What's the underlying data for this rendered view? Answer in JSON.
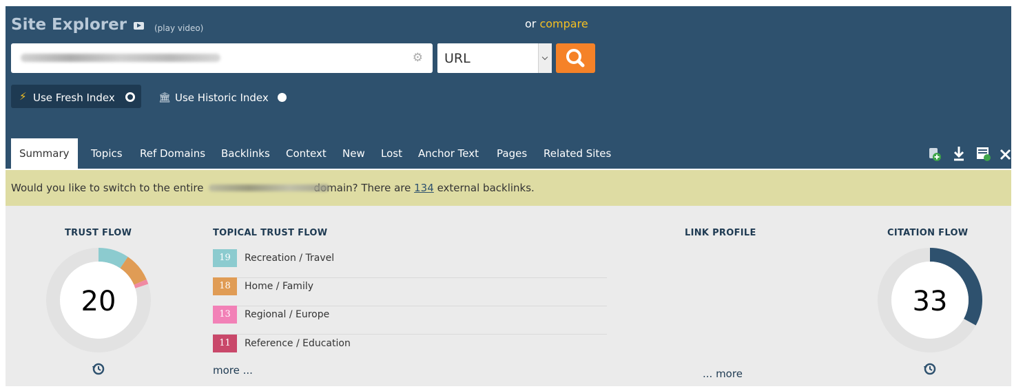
{
  "header": {
    "title": "Site Explorer",
    "video_icon": "play-video-icon",
    "play_video": "(play video)",
    "or_text": "or",
    "compare": "compare"
  },
  "search": {
    "gear_icon": "gear-icon",
    "mode": "URL",
    "search_icon": "magnifier-icon"
  },
  "index": {
    "fresh_label": "Use Fresh Index",
    "historic_label": "Use Historic Index",
    "selected": "fresh"
  },
  "tabs": [
    {
      "label": "Summary",
      "active": true
    },
    {
      "label": "Topics"
    },
    {
      "label": "Ref Domains"
    },
    {
      "label": "Backlinks"
    },
    {
      "label": "Context"
    },
    {
      "label": "New"
    },
    {
      "label": "Lost"
    },
    {
      "label": "Anchor Text"
    },
    {
      "label": "Pages"
    },
    {
      "label": "Related Sites"
    }
  ],
  "toolbar_icons": [
    "add-to-bucket-icon",
    "download-icon",
    "report-icon",
    "tools-icon"
  ],
  "notice": {
    "prefix": "Would you like to switch to the entire",
    "suffix": "domain? There are",
    "count": "134",
    "tail": "external backlinks."
  },
  "trust_flow": {
    "title": "TRUST FLOW",
    "value": "20",
    "segments": [
      {
        "value": 19,
        "color": "#8ccbcf"
      },
      {
        "value": 18,
        "color": "#e09c55"
      },
      {
        "value": 3,
        "color": "#f08aa2"
      }
    ]
  },
  "topical": {
    "title": "TOPICAL TRUST FLOW",
    "items": [
      {
        "score": "19",
        "label": "Recreation / Travel",
        "color": "#8ccbcf"
      },
      {
        "score": "18",
        "label": "Home / Family",
        "color": "#e09c55"
      },
      {
        "score": "13",
        "label": "Regional / Europe",
        "color": "#f281b7"
      },
      {
        "score": "11",
        "label": "Reference / Education",
        "color": "#c9486a"
      }
    ],
    "more": "more ..."
  },
  "link_profile": {
    "title": "LINK PROFILE",
    "more": "... more"
  },
  "citation_flow": {
    "title": "CITATION FLOW",
    "value": "33",
    "fraction": 0.33,
    "color": "#2e516e"
  }
}
